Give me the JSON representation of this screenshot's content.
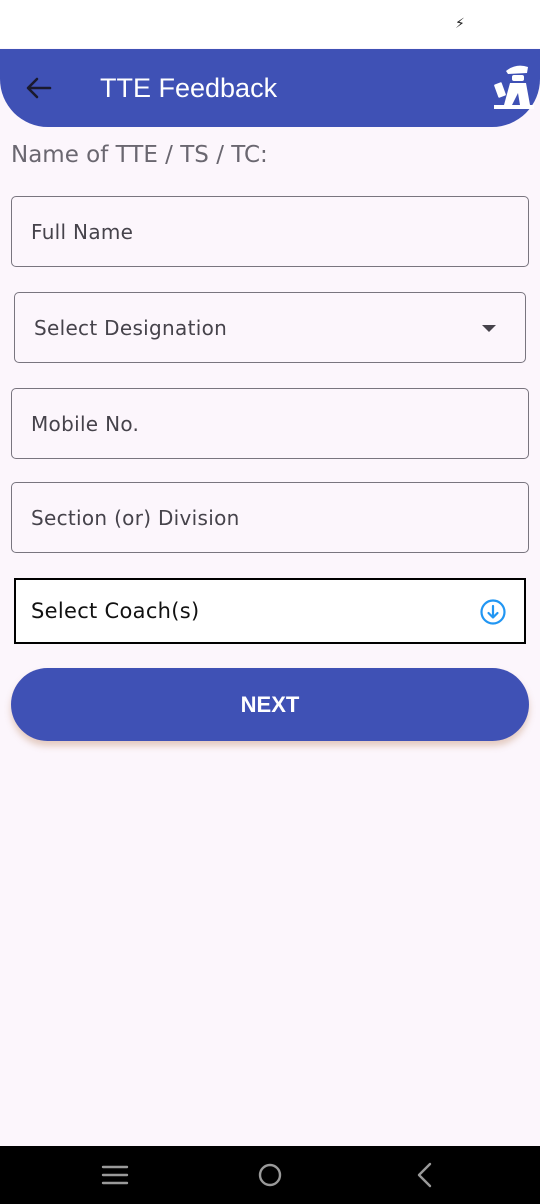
{
  "status_bar": {
    "charging_glyph": "⚡"
  },
  "app_bar": {
    "title": "TTE Feedback",
    "back_icon": "arrow-left-icon",
    "logo_icon": "ticket-examiner-icon",
    "color": "#3f51b5"
  },
  "form": {
    "section_label": "Name of TTE / TS / TC:",
    "full_name_placeholder": "Full Name",
    "designation_placeholder": "Select Designation",
    "mobile_placeholder": "Mobile No.",
    "section_division_placeholder": "Section (or) Division",
    "coach_placeholder": "Select Coach(s)",
    "coach_icon": "download-circle-icon"
  },
  "actions": {
    "next_label": "NEXT"
  },
  "nav_bar": {
    "items": [
      "menu-icon",
      "home-icon",
      "back-icon"
    ]
  },
  "colors": {
    "accent": "#3f51b5",
    "background": "#fcf6fc",
    "coach_icon": "#2196f3"
  }
}
